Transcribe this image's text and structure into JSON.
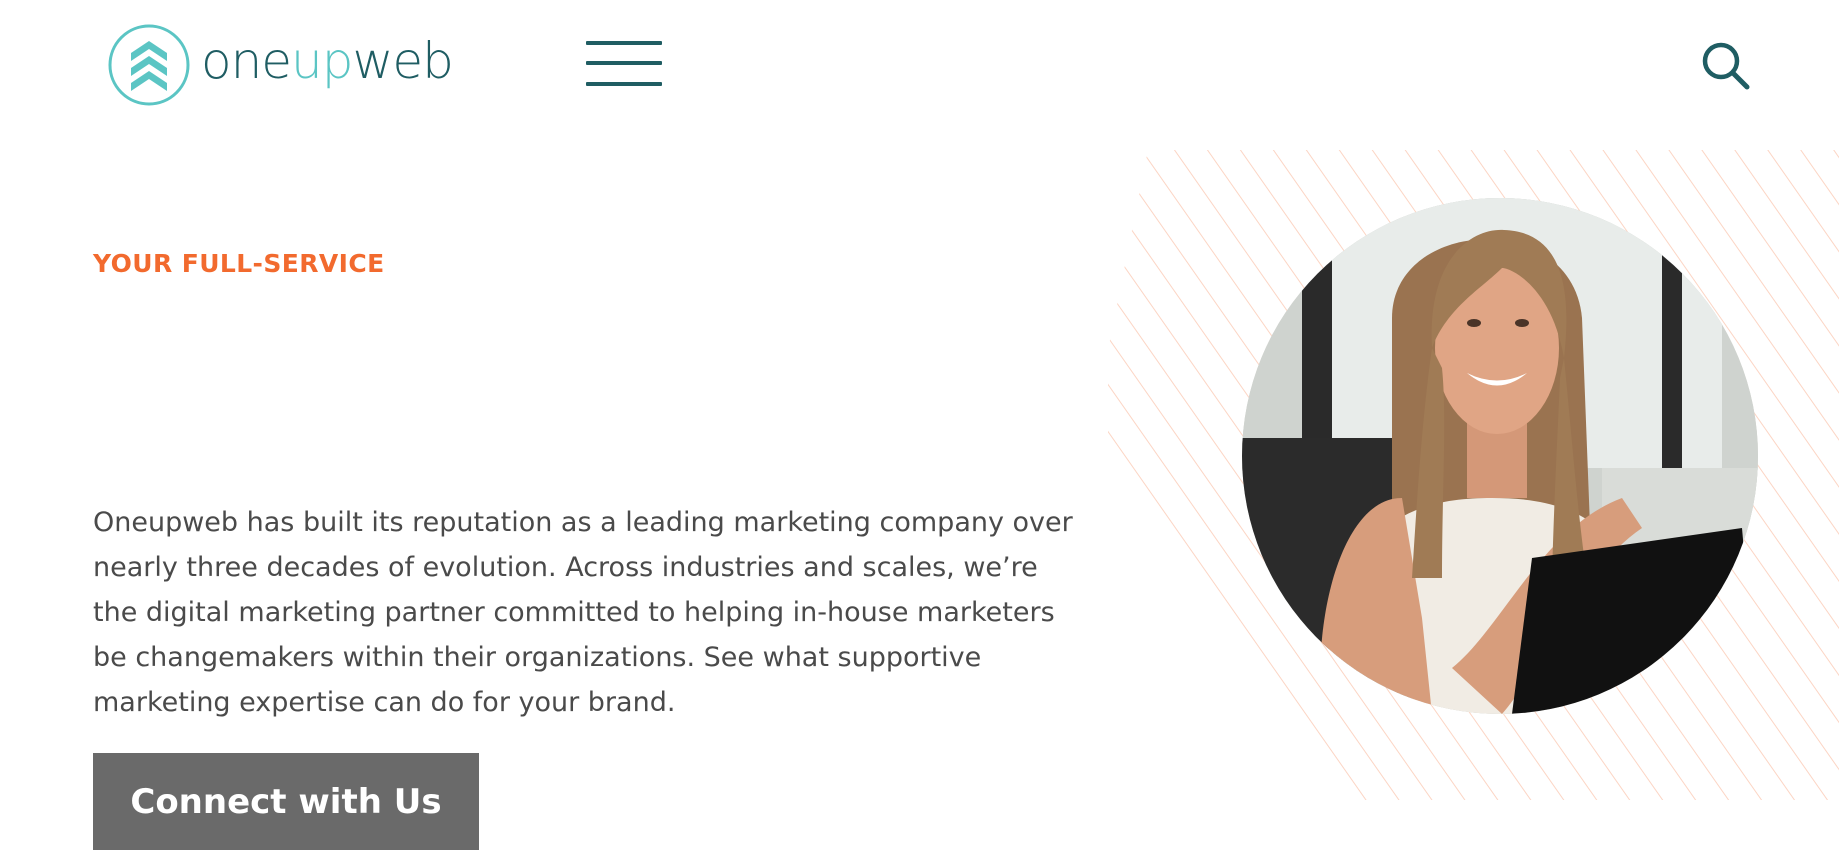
{
  "header": {
    "logo": {
      "parts": [
        "one",
        "up",
        "web"
      ],
      "colors": {
        "primary": "#1f5d63",
        "accent": "#5bc5c4"
      },
      "icon": "chevron-up-arrows-icon"
    },
    "menu_icon": "hamburger-menu-icon",
    "search_icon": "search-icon"
  },
  "hero": {
    "eyebrow": "YOUR FULL-SERVICE",
    "intro": "Oneupweb has built its reputation as a leading marketing company over nearly three decades of evolution. Across industries and scales, we’re the digital marketing partner committed to helping in-house marketers be changemakers within their organizations. See what supportive marketing expertise can do for your brand.",
    "cta_label": "Connect with Us",
    "image": "smiling-woman-at-laptop-photo"
  },
  "colors": {
    "eyebrow": "#f26a2e",
    "body_text": "#4a4a4a",
    "cta_background": "#6a6a6a",
    "stripe": "#fcd5c4",
    "brand_dark": "#1f5d63",
    "brand_light": "#5bc5c4"
  }
}
